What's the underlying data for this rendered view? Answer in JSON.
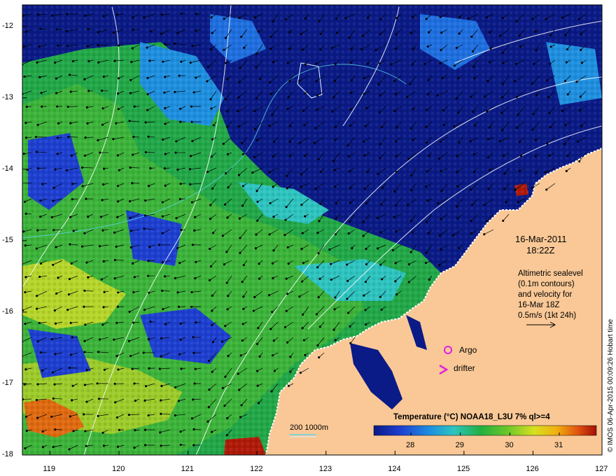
{
  "map": {
    "x_ticks": [
      "119",
      "120",
      "121",
      "122",
      "123",
      "124",
      "125",
      "126",
      "127"
    ],
    "y_ticks": [
      "-12",
      "-13",
      "-14",
      "-15",
      "-16",
      "-17",
      "-18"
    ],
    "lon_range": [
      118.6,
      127
    ],
    "lat_range": [
      -18,
      -11.7
    ],
    "land_color": "#f9c896",
    "ocean_deep_color": "#0a1a86"
  },
  "annotations": {
    "date": "16-Mar-2011",
    "time": "18:22Z",
    "altimetry_lines": [
      "Altimetric sealevel",
      "(0.1m contours)",
      "and velocity for",
      "16-Mar 18Z",
      "0.5m/s (1kt 24h)"
    ],
    "argo_label": "Argo",
    "drifter_label": "drifter",
    "depth_label": "200  1000m"
  },
  "colorbar": {
    "title": "Temperature (°C) NOAA18_L3U 7% ql>=4",
    "ticks": [
      "28",
      "29",
      "30",
      "31"
    ],
    "tick_values": [
      28,
      29,
      30,
      31
    ],
    "range": [
      27.25,
      31.75
    ],
    "colors": [
      "#0a1a86",
      "#1d3fd0",
      "#1e8fe0",
      "#2ec4c0",
      "#22b040",
      "#6cc62a",
      "#d6e020",
      "#f0b010",
      "#e05010",
      "#a01008"
    ]
  },
  "credit": "© IMOS 06-Apr-2015 00:09:26 Hobart time"
}
